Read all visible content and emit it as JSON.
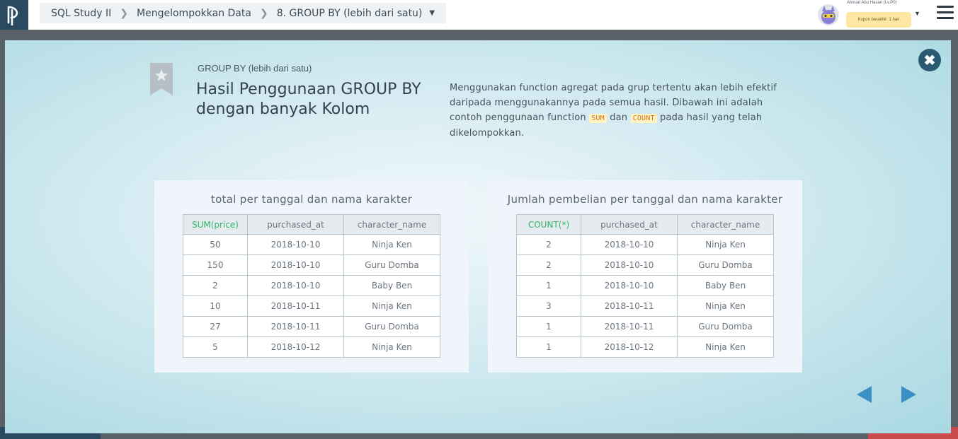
{
  "header": {
    "breadcrumb": [
      "SQL Study II",
      "Mengelompokkan Data",
      "8. GROUP BY (lebih dari satu)"
    ],
    "user_name": "Ahmad Abu Hasan (Lv.P0)",
    "coupon": "Kupon berakhir: 1 hari"
  },
  "slide": {
    "kicker": "GROUP BY (lebih dari satu)",
    "title": "Hasil Penggunaan GROUP BY dengan banyak Kolom",
    "desc_1": "Menggunakan function agregat pada grup tertentu akan lebih efektif daripada menggunakannya pada semua hasil. Dibawah ini adalah contoh penggunaan function ",
    "code_sum": "SUM",
    "desc_2": " dan ",
    "code_count": "COUNT",
    "desc_3": " pada hasil yang telah dikelompokkan."
  },
  "table_left": {
    "title": "total per tanggal dan nama karakter",
    "headers": [
      "SUM(price)",
      "purchased_at",
      "character_name"
    ],
    "rows": [
      [
        "50",
        "2018-10-10",
        "Ninja Ken"
      ],
      [
        "150",
        "2018-10-10",
        "Guru Domba"
      ],
      [
        "2",
        "2018-10-10",
        "Baby Ben"
      ],
      [
        "10",
        "2018-10-11",
        "Ninja Ken"
      ],
      [
        "27",
        "2018-10-11",
        "Guru Domba"
      ],
      [
        "5",
        "2018-10-12",
        "Ninja Ken"
      ]
    ]
  },
  "table_right": {
    "title": "Jumlah pembelian per tanggal dan nama karakter",
    "headers": [
      "COUNT(*)",
      "purchased_at",
      "character_name"
    ],
    "rows": [
      [
        "2",
        "2018-10-10",
        "Ninja Ken"
      ],
      [
        "2",
        "2018-10-10",
        "Guru Domba"
      ],
      [
        "1",
        "2018-10-10",
        "Baby Ben"
      ],
      [
        "3",
        "2018-10-11",
        "Ninja Ken"
      ],
      [
        "1",
        "2018-10-11",
        "Guru Domba"
      ],
      [
        "1",
        "2018-10-12",
        "Ninja Ken"
      ]
    ]
  },
  "colors": {
    "accent_green": "#2fb56a",
    "nav_arrow": "#3a8fc4",
    "close_bg": "#2a5a72",
    "code_bg": "#fff3c2",
    "code_text": "#d0761e"
  },
  "icons": {
    "logo": "progate-logo-icon",
    "close": "close-icon",
    "bookmark": "bookmark-star-icon",
    "prev": "prev-arrow-icon",
    "next": "next-arrow-icon",
    "menu": "hamburger-menu-icon"
  }
}
